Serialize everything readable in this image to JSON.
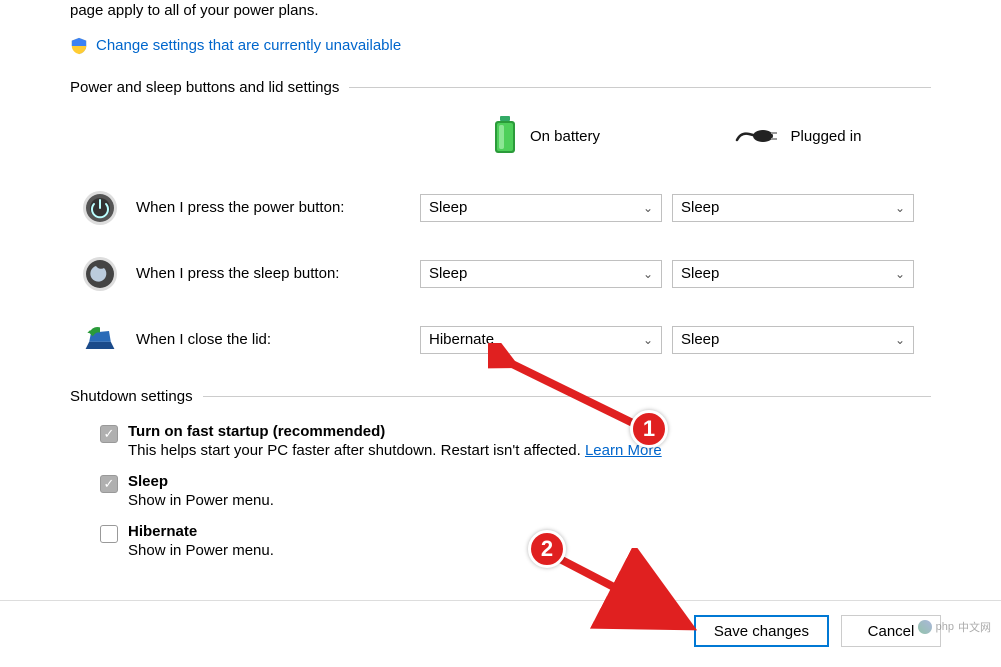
{
  "intro": {
    "fragment": "page apply to all of your power plans.",
    "change_link": "Change settings that are currently unavailable"
  },
  "section1": {
    "title": "Power and sleep buttons and lid settings",
    "col_battery": "On battery",
    "col_plugged": "Plugged in",
    "rows": [
      {
        "label": "When I press the power button:",
        "battery": "Sleep",
        "plugged": "Sleep"
      },
      {
        "label": "When I press the sleep button:",
        "battery": "Sleep",
        "plugged": "Sleep"
      },
      {
        "label": "When I close the lid:",
        "battery": "Hibernate",
        "plugged": "Sleep"
      }
    ]
  },
  "section2": {
    "title": "Shutdown settings",
    "items": [
      {
        "title": "Turn on fast startup (recommended)",
        "desc": "This helps start your PC faster after shutdown. Restart isn't affected.",
        "checked": true,
        "learn_more": "Learn More"
      },
      {
        "title": "Sleep",
        "desc": "Show in Power menu.",
        "checked": true
      },
      {
        "title": "Hibernate",
        "desc": "Show in Power menu.",
        "checked": false
      }
    ]
  },
  "buttons": {
    "save": "Save changes",
    "cancel": "Cancel"
  },
  "watermark": "中文网",
  "annotations": {
    "marker1": "1",
    "marker2": "2"
  }
}
